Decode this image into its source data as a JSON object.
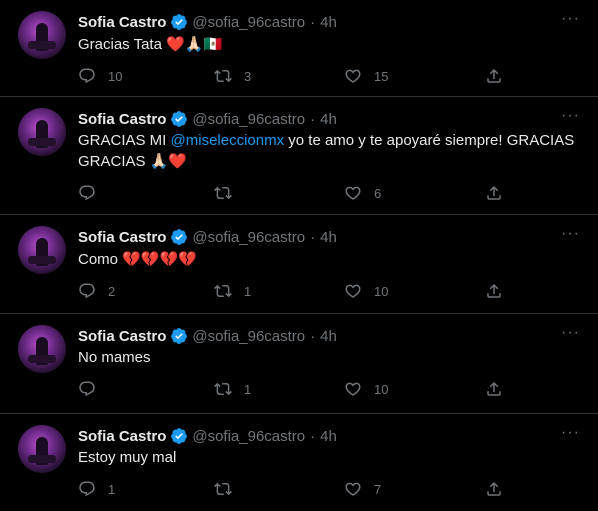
{
  "user": {
    "name": "Sofia Castro",
    "handle": "@sofia_96castro",
    "dot": "·",
    "time": "4h"
  },
  "icons": {
    "reply": "reply-icon",
    "retweet": "retweet-icon",
    "like": "heart-icon",
    "share": "share-icon",
    "more": "more-icon",
    "verified": "verified-badge-icon"
  },
  "colors": {
    "background": "#000000",
    "text": "#e7e9ea",
    "muted": "#71767b",
    "link": "#1d9bf0",
    "verified": "#1d9bf0"
  },
  "tweets": [
    {
      "text": "Gracias Tata",
      "emoji": "❤️🙏🏻🇲🇽",
      "replies": "10",
      "retweets": "3",
      "likes": "15"
    },
    {
      "text_pre": "GRACIAS MI ",
      "mention": "@miseleccionmx",
      "text_post": " yo te amo y te apoyaré siempre! GRACIAS GRACIAS",
      "emoji": "🙏🏻❤️",
      "replies": "",
      "retweets": "",
      "likes": "6"
    },
    {
      "text": "Como",
      "emoji": "💔💔💔💔",
      "replies": "2",
      "retweets": "1",
      "likes": "10"
    },
    {
      "text": "No mames",
      "replies": "",
      "retweets": "1",
      "likes": "10"
    },
    {
      "text": "Estoy muy mal",
      "replies": "1",
      "retweets": "",
      "likes": "7"
    }
  ]
}
